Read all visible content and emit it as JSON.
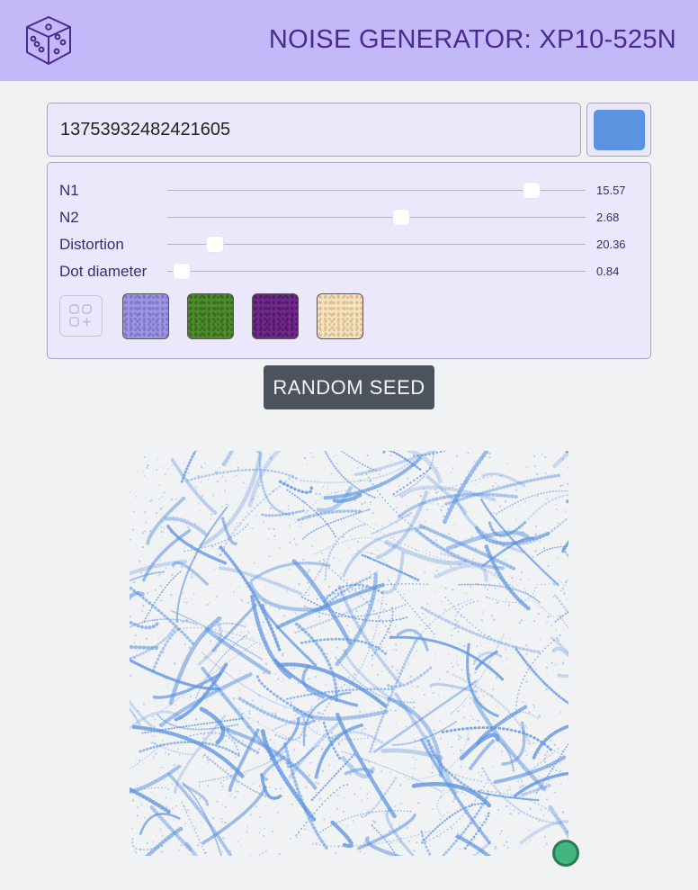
{
  "header": {
    "title": "NOISE GENERATOR: XP10-525N",
    "logo_icon": "dice-icon"
  },
  "seed": {
    "value": "13753932482421605",
    "color": "#5b93e0"
  },
  "sliders": [
    {
      "label": "N1",
      "value_text": "15.57",
      "fraction": 0.87
    },
    {
      "label": "N2",
      "value_text": "2.68",
      "fraction": 0.56
    },
    {
      "label": "Distortion",
      "value_text": "20.36",
      "fraction": 0.115
    },
    {
      "label": "Dot diameter",
      "value_text": "0.84",
      "fraction": 0.035
    }
  ],
  "presets": {
    "add_icon": "add-grid-icon",
    "items": [
      {
        "name": "lavender",
        "color": "#9d95e0",
        "speckle": "#7f76d0"
      },
      {
        "name": "green",
        "color": "#4f8a2d",
        "speckle": "#3a6c1f"
      },
      {
        "name": "purple",
        "color": "#6e2a8a",
        "speckle": "#53196b"
      },
      {
        "name": "cream",
        "color": "#f2e3c6",
        "speckle": "#e2bf86"
      }
    ]
  },
  "random_button": {
    "label": "RANDOM SEED"
  },
  "canvas": {
    "dot_color": "#5b93e0",
    "status_color": "#43b581"
  }
}
